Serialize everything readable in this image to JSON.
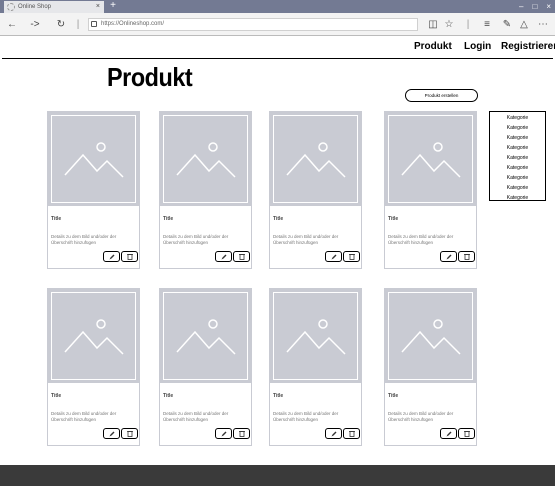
{
  "browser": {
    "tab_title": "Online Shop",
    "new_tab": "+",
    "close_tab": "×",
    "window_controls": [
      "–",
      "□",
      "×"
    ],
    "url": "https://Onlineshop.com/",
    "nav_icons": [
      "back-icon",
      "forward-icon",
      "reload-icon"
    ]
  },
  "nav": {
    "links": [
      "Produkt",
      "Login",
      "Registrieren"
    ]
  },
  "page": {
    "heading": "Produkt",
    "create_button": "Produkt erstellen",
    "categories": [
      "Kategorie",
      "Kategorie",
      "Kategorie",
      "Kategorie",
      "Kategorie",
      "Kategorie",
      "Kategorie",
      "Kategorie",
      "Kategorie"
    ]
  },
  "cards": [
    {
      "title": "Title",
      "desc": "Details zu dem Bild und/oder der Überschrift hinzufügen"
    },
    {
      "title": "Title",
      "desc": "Details zu dem Bild und/oder der Überschrift hinzufügen"
    },
    {
      "title": "Title",
      "desc": "Details zu dem Bild und/oder der Überschrift hinzufügen"
    },
    {
      "title": "Title",
      "desc": "Details zu dem Bild und/oder der Überschrift hinzufügen"
    },
    {
      "title": "Title",
      "desc": "Details zu dem Bild und/oder der Überschrift hinzufügen"
    },
    {
      "title": "Title",
      "desc": "Details zu dem Bild und/oder der Überschrift hinzufügen"
    },
    {
      "title": "Title",
      "desc": "Details zu dem Bild und/oder der Überschrift hinzufügen"
    },
    {
      "title": "Title",
      "desc": "Details zu dem Bild und/oder der Überschrift hinzufügen"
    }
  ]
}
